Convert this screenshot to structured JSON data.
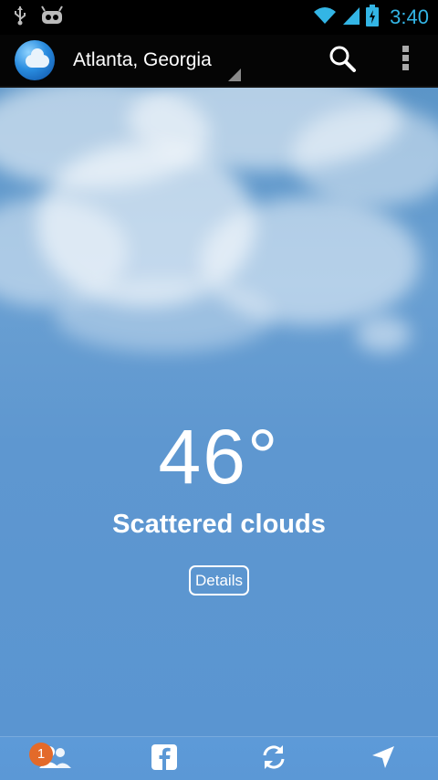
{
  "status_bar": {
    "time": "3:40",
    "icons": [
      "usb-icon",
      "android-debug-icon",
      "wifi-icon",
      "signal-icon",
      "battery-charging-icon"
    ],
    "accent_color": "#33b5e5"
  },
  "action_bar": {
    "app_icon": "weather-globe-icon",
    "location": "Atlanta, Georgia",
    "search_icon": "search-icon",
    "overflow_icon": "overflow-menu-icon"
  },
  "weather": {
    "temperature": "46°",
    "condition": "Scattered clouds",
    "details_label": "Details"
  },
  "bottom_bar": {
    "friends_badge": "1",
    "items": [
      "friends-icon",
      "facebook-icon",
      "refresh-icon",
      "location-arrow-icon"
    ]
  }
}
